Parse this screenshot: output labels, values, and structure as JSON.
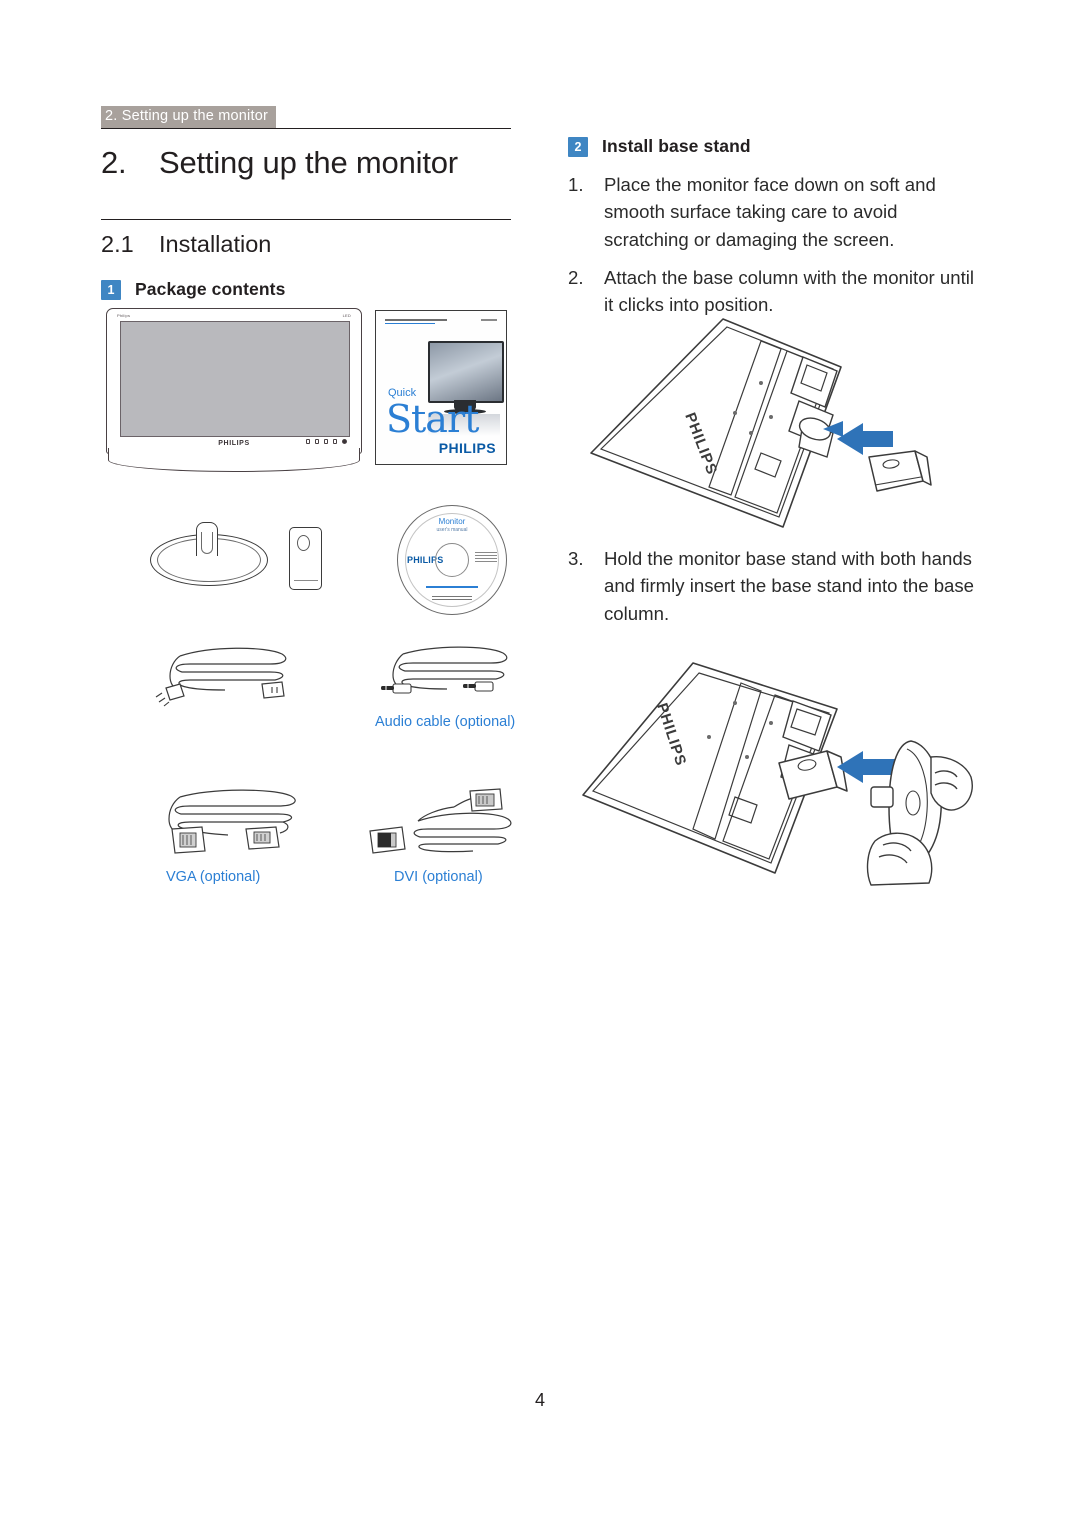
{
  "running_header": "2. Setting up the monitor",
  "chapter": {
    "number": "2.",
    "title": "Setting up the monitor"
  },
  "section": {
    "number": "2.1",
    "title": "Installation"
  },
  "left_column": {
    "badge_heading": {
      "badge": "1",
      "label": "Package contents"
    },
    "monitor_figure": {
      "brand": "PHILIPS",
      "top_left_mark": "Philips",
      "top_right_mark": "LED"
    },
    "quick_start_guide": {
      "quick": "Quick",
      "start": "Start",
      "brand": "PHILIPS"
    },
    "cd_figure": {
      "title": "Monitor",
      "subtitle": "user's manual",
      "brand": "PHILIPS"
    },
    "captions": {
      "audio_cable": "Audio cable (optional)",
      "vga": "VGA (optional)",
      "dvi": "DVI (optional)"
    }
  },
  "right_column": {
    "badge_heading": {
      "badge": "2",
      "label": "Install base stand"
    },
    "steps": [
      {
        "number": "1.",
        "text": "Place the monitor face down on soft and smooth surface taking care to avoid scratching or damaging the screen."
      },
      {
        "number": "2.",
        "text": "Attach the base column with the monitor until it clicks into position."
      },
      {
        "number": "3.",
        "text": "Hold the monitor base stand with both hands and firmly insert the base stand into the base column."
      }
    ],
    "illustrations": {
      "figure_1_brand": "PHILIPS",
      "figure_2_brand": "PHILIPS"
    }
  },
  "page_number": "4",
  "colors": {
    "accent_blue": "#2b7fd4",
    "badge_blue": "#3f86c3",
    "header_gray": "#a8a19c",
    "arrow_blue": "#2f73b8",
    "text": "#231f20"
  }
}
